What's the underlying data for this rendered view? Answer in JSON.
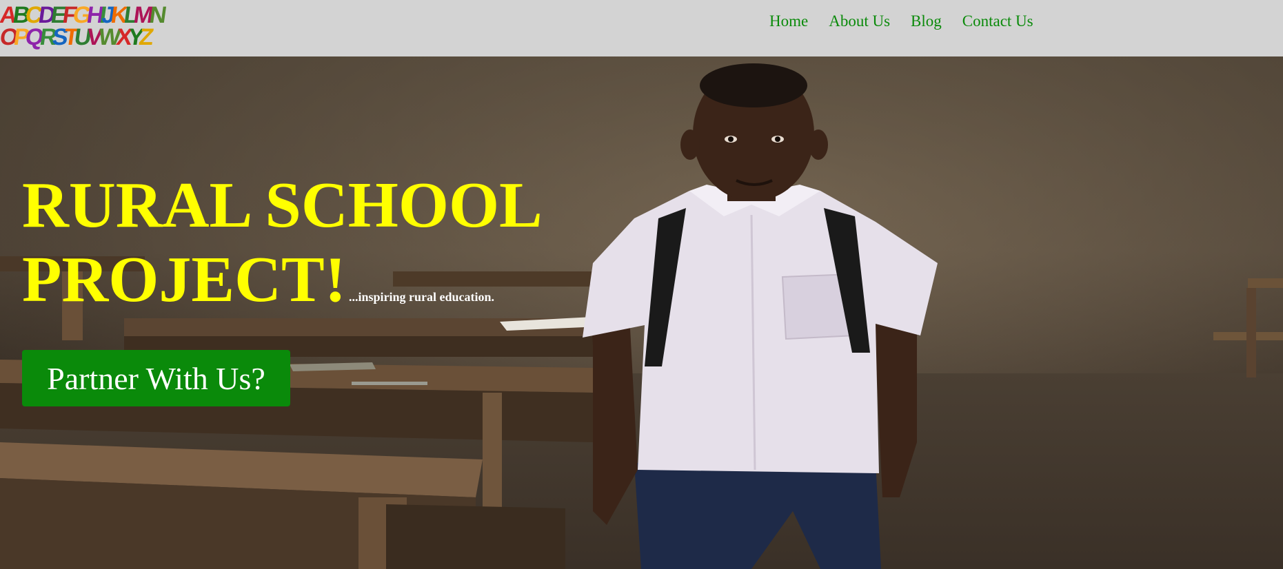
{
  "logo": {
    "alt": "ABCDEFGHIJKLMN OPQRSTUVWXYZ alphabet logo",
    "row1": "ABCDEFGHIJKLMN",
    "row2": "OPQRSTUVWXYZ",
    "colors": [
      "#d62828",
      "#1f7a1f",
      "#e0a800",
      "#6a1b9a",
      "#2e7d32",
      "#c62828",
      "#f9a825",
      "#8e24aa",
      "#388e3c",
      "#1565c0",
      "#ef6c00",
      "#2e7d32",
      "#ad1457",
      "#558b2f"
    ]
  },
  "nav": {
    "items": [
      {
        "label": "Home"
      },
      {
        "label": "About Us"
      },
      {
        "label": "Blog"
      },
      {
        "label": "Contact Us"
      }
    ],
    "color": "#0a8a0a"
  },
  "hero": {
    "title_line1": "RURAL SCHOOL",
    "title_line2": "PROJECT!",
    "tagline": "...inspiring rural education.",
    "cta_label": "Partner With Us?",
    "title_color": "#ffff00",
    "cta_color": "#0a8a0a",
    "image_description": "Boy in white shirt with backpack standing in a classroom with wooden desks"
  },
  "colors": {
    "header_bg": "#d3d3d3"
  }
}
